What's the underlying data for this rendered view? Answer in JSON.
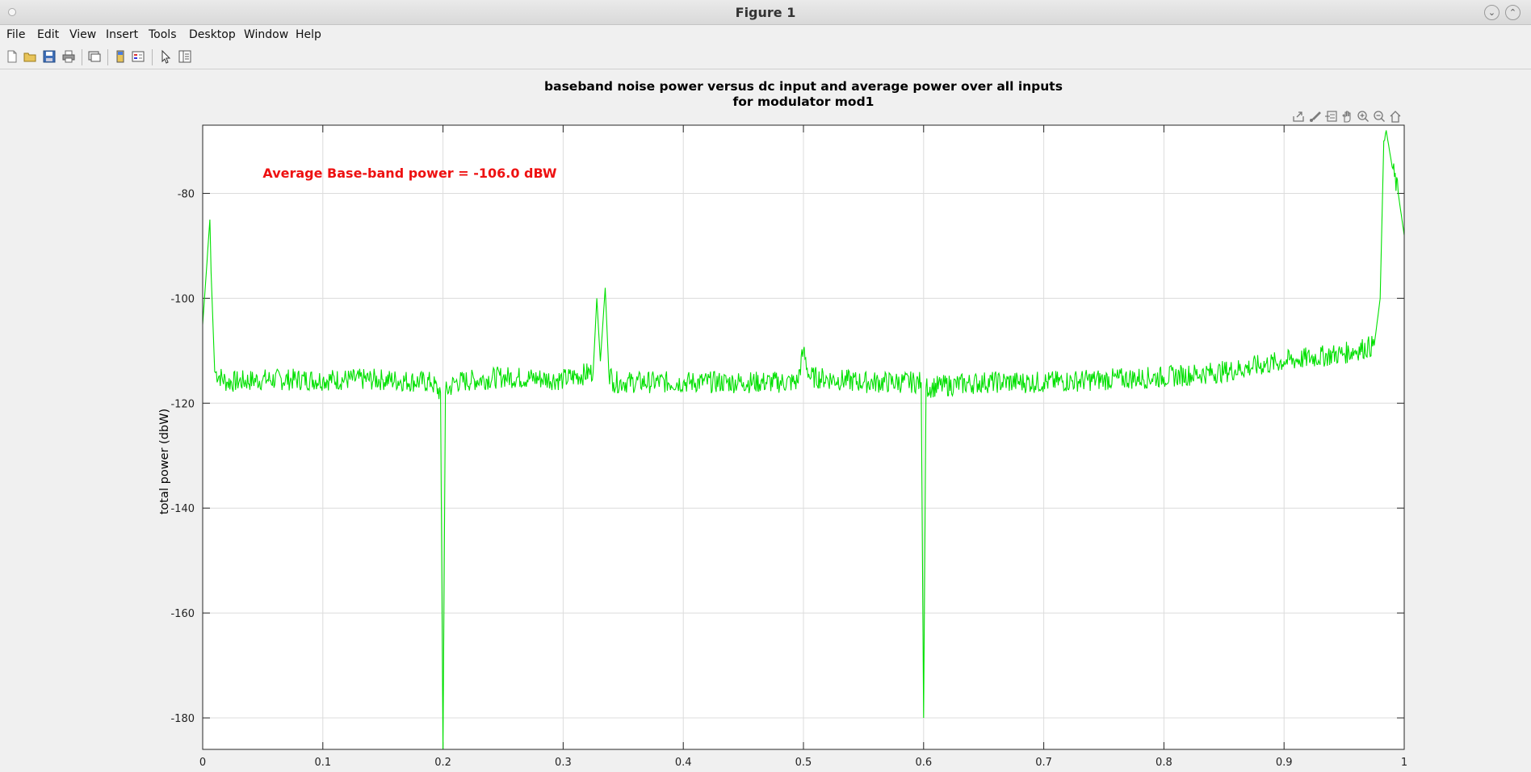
{
  "window": {
    "title": "Figure 1"
  },
  "menu": [
    "File",
    "Edit",
    "View",
    "Insert",
    "Tools",
    "Desktop",
    "Window",
    "Help"
  ],
  "toolbar": [
    "new-figure-icon",
    "open-icon",
    "save-icon",
    "print-icon",
    "link-plot-icon",
    "colorbar-icon",
    "legend-icon",
    "pointer-icon",
    "property-inspector-icon"
  ],
  "axes_toolbar": [
    "export-icon",
    "brush-icon",
    "datatip-icon",
    "pan-icon",
    "zoom-in-icon",
    "zoom-out-icon",
    "home-icon"
  ],
  "chart_data": {
    "type": "line",
    "title_line1": "baseband noise power versus dc input and average power over all inputs",
    "title_line2": "for modulator mod1",
    "ylabel": "total power (dbW)",
    "xlim": [
      0,
      1
    ],
    "ylim": [
      -186,
      -67
    ],
    "xticks": [
      0,
      0.1,
      0.2,
      0.3,
      0.4,
      0.5,
      0.6,
      0.7,
      0.8,
      0.9,
      1
    ],
    "xtick_labels": [
      "0",
      "0.1",
      "0.2",
      "0.3",
      "0.4",
      "0.5",
      "0.6",
      "0.7",
      "0.8",
      "0.9",
      "1"
    ],
    "yticks": [
      -80,
      -100,
      -120,
      -140,
      -160,
      -180
    ],
    "ytick_labels": [
      "-80",
      "-100",
      "-120",
      "-140",
      "-160",
      "-180"
    ],
    "grid": true,
    "line_color": "#00e000",
    "annotation": {
      "text": "Average Base-band power = -106.0 dBW",
      "color": "#ee1111",
      "x": 0.05,
      "y": -77
    },
    "series": [
      {
        "x": [
          0,
          0.003,
          0.006,
          0.007,
          0.01,
          0.02,
          0.05,
          0.1,
          0.15,
          0.19,
          0.198,
          0.2,
          0.202,
          0.21,
          0.25,
          0.3,
          0.325,
          0.328,
          0.331,
          0.335,
          0.338,
          0.342,
          0.35,
          0.4,
          0.45,
          0.495,
          0.5,
          0.505,
          0.55,
          0.598,
          0.6,
          0.602,
          0.65,
          0.7,
          0.75,
          0.8,
          0.85,
          0.9,
          0.95,
          0.975,
          0.98,
          0.983,
          0.985,
          0.99,
          0.995,
          1
        ],
        "y": [
          -105,
          -95,
          -85,
          -95,
          -114,
          -116,
          -115.5,
          -115.5,
          -115.5,
          -116,
          -118,
          -186,
          -118,
          -116,
          -115,
          -115.5,
          -114,
          -100,
          -112,
          -98,
          -114,
          -116,
          -116,
          -116,
          -116,
          -116,
          -110,
          -115,
          -116,
          -116,
          -180,
          -117,
          -116,
          -116,
          -115.5,
          -115,
          -114,
          -112,
          -110.5,
          -109,
          -100,
          -70,
          -68,
          -75,
          -80,
          -88
        ]
      }
    ]
  }
}
